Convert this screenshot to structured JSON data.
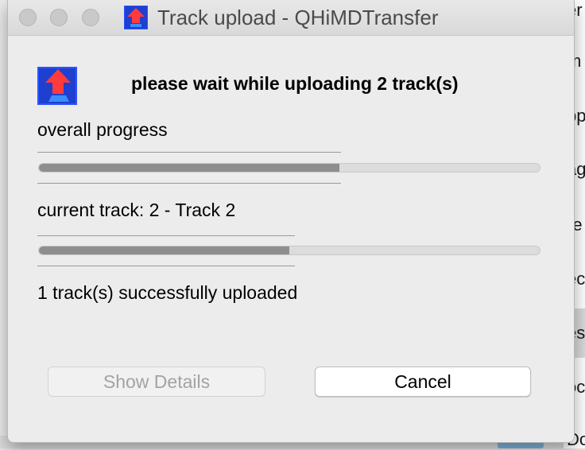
{
  "window": {
    "title": "Track upload - QHiMDTransfer",
    "app_icon": "upload-arrow-icon"
  },
  "dialog": {
    "heading": "please wait while uploading 2 track(s)",
    "overall_label": "overall progress",
    "overall_progress": 0.6,
    "current_track_label": "current track: 2 - Track 2",
    "current_progress": 0.5,
    "status_text": "1 track(s) successfully uploaded",
    "buttons": {
      "show_details": "Show Details",
      "cancel": "Cancel"
    }
  },
  "background_list": {
    "items": [
      "er",
      "m",
      "pp",
      "ag",
      "re",
      "ec",
      "es",
      "oc",
      "Do"
    ],
    "selected_index": 6
  },
  "colors": {
    "progress_fill": "#8e8e8e",
    "progress_track": "#dcdcdc",
    "icon_blue": "#1e3fd0",
    "icon_red": "#ff3b3b"
  }
}
